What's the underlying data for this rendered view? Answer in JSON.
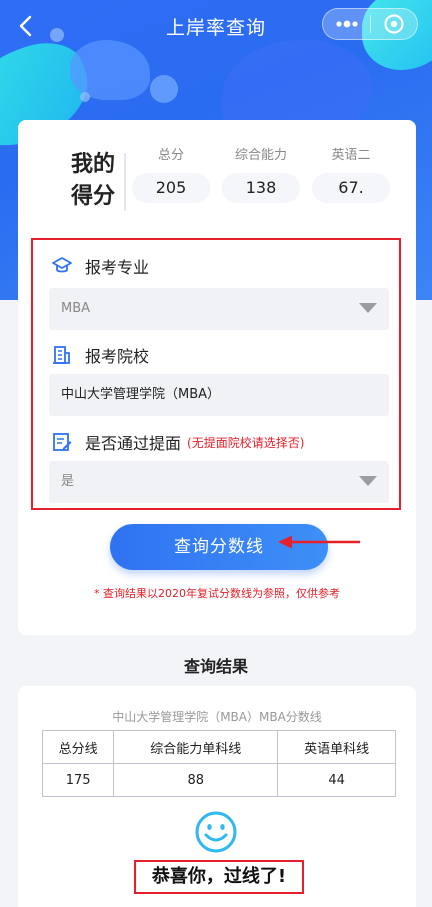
{
  "nav": {
    "title": "上岸率查询"
  },
  "scores": {
    "heading_line1": "我的",
    "heading_line2": "得分",
    "columns": [
      {
        "label": "总分",
        "value": "205"
      },
      {
        "label": "综合能力",
        "value": "138"
      },
      {
        "label": "英语二",
        "value": "67."
      }
    ]
  },
  "form": {
    "major": {
      "label": "报考专业",
      "value": "MBA"
    },
    "school": {
      "label": "报考院校",
      "value": "中山大学管理学院（MBA）"
    },
    "passed": {
      "label": "是否通过提面",
      "hint": "(无提面院校请选择否)",
      "value": "是"
    }
  },
  "query_button": "查询分数线",
  "note": "* 查询结果以2020年复试分数线为参照，仅供参考",
  "result": {
    "title": "查询结果",
    "caption": "中山大学管理学院（MBA）MBA分数线",
    "headers": [
      "总分线",
      "综合能力单科线",
      "英语单科线"
    ],
    "values": [
      "175",
      "88",
      "44"
    ],
    "congrats": "恭喜你，过线了!"
  },
  "colors": {
    "accent": "#2f72f2",
    "warning": "#e5202a",
    "smile": "#2fb8f0"
  }
}
